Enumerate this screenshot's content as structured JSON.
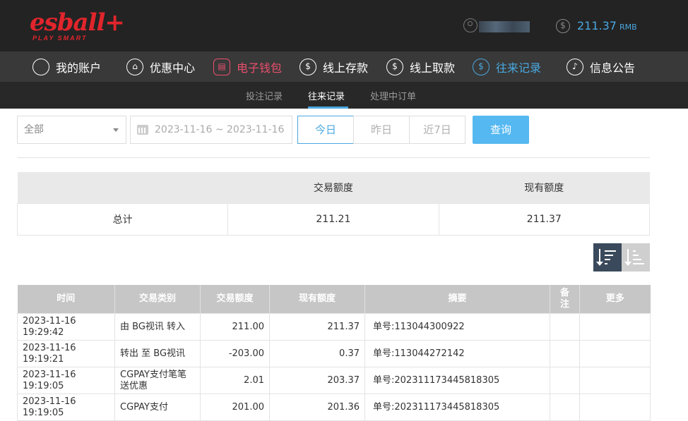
{
  "header": {
    "logo_text": "esball+",
    "logo_tagline": "PLAY SMART",
    "balance": "211.37",
    "currency": "RMB"
  },
  "nav": {
    "items": [
      {
        "label": "我的账户",
        "icon": "user-icon"
      },
      {
        "label": "优惠中心",
        "icon": "gift-icon"
      },
      {
        "label": "电子钱包",
        "icon": "wallet-icon"
      },
      {
        "label": "线上存款",
        "icon": "deposit-icon"
      },
      {
        "label": "线上取款",
        "icon": "withdraw-icon"
      },
      {
        "label": "往来记录",
        "icon": "records-icon"
      },
      {
        "label": "信息公告",
        "icon": "bell-icon"
      }
    ],
    "colors": {
      "highlight_red": "#e9506d",
      "active_blue": "#49a9e0"
    }
  },
  "subnav": {
    "items": [
      "投注记录",
      "往来记录",
      "处理中订单"
    ],
    "active": "往来记录"
  },
  "filters": {
    "type_select": "全部",
    "date_range": "2023-11-16 ~ 2023-11-16",
    "quick_ranges": [
      "今日",
      "昨日",
      "近7日"
    ],
    "active_range": "今日",
    "query_label": "查询"
  },
  "summary": {
    "headers": [
      "",
      "交易额度",
      "现有额度"
    ],
    "row": {
      "label": "总计",
      "amount": "211.21",
      "balance": "211.37"
    }
  },
  "records": {
    "headers": [
      "时间",
      "交易类别",
      "交易额度",
      "现有额度",
      "摘要",
      "备注",
      "更多"
    ],
    "rows": [
      {
        "time": "2023-11-16 19:29:42",
        "type": "由 BG视讯 转入",
        "amount": "211.00",
        "balance": "211.37",
        "summary": "单号:113044300922",
        "note": "",
        "more": ""
      },
      {
        "time": "2023-11-16 19:19:21",
        "type": "转出 至 BG视讯",
        "amount": "-203.00",
        "balance": "0.37",
        "summary": "单号:113044272142",
        "note": "",
        "more": ""
      },
      {
        "time": "2023-11-16 19:19:05",
        "type": "CGPAY支付笔笔送优惠",
        "amount": "2.01",
        "balance": "203.37",
        "summary": "单号:202311173445818305",
        "note": "",
        "more": ""
      },
      {
        "time": "2023-11-16 19:19:05",
        "type": "CGPAY支付",
        "amount": "201.00",
        "balance": "201.36",
        "summary": "单号:202311173445818305",
        "note": "",
        "more": ""
      }
    ]
  }
}
